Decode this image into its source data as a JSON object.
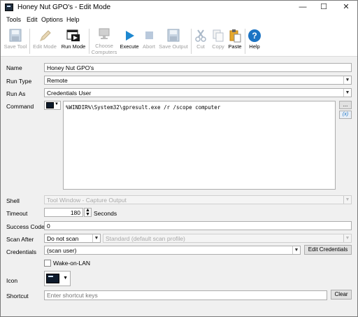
{
  "window": {
    "title": "Honey Nut GPO's - Edit Mode",
    "minimize_glyph": "—",
    "maximize_glyph": "☐",
    "close_glyph": "✕"
  },
  "menu": [
    "Tools",
    "Edit",
    "Options",
    "Help"
  ],
  "toolbar": {
    "save_tool": "Save Tool",
    "edit_mode": "Edit Mode",
    "run_mode": "Run Mode",
    "choose_computers_line1": "Choose",
    "choose_computers_line2": "Computers",
    "execute": "Execute",
    "abort": "Abort",
    "save_output": "Save Output",
    "cut": "Cut",
    "copy": "Copy",
    "paste": "Paste",
    "help": "Help"
  },
  "form": {
    "name_label": "Name",
    "name_value": "Honey Nut GPO's",
    "run_type_label": "Run Type",
    "run_type_value": "Remote",
    "run_as_label": "Run As",
    "run_as_value": "Credentials User",
    "command_label": "Command",
    "command_value": "%WINDIR%\\System32\\gpresult.exe /r /scope computer",
    "ellipsis": "...",
    "variables_label": "(x)",
    "shell_label": "Shell",
    "shell_value": "Tool Window - Capture Output",
    "timeout_label": "Timeout",
    "timeout_value": "180",
    "timeout_unit": "Seconds",
    "success_codes_label": "Success Codes",
    "success_codes_value": "0",
    "scan_after_label": "Scan After",
    "scan_after_value": "Do not scan",
    "scan_profile_value": "Standard (default scan profile)",
    "credentials_label": "Credentials",
    "credentials_value": "(scan user)",
    "edit_credentials": "Edit Credentials",
    "wake_on_lan": "Wake-on-LAN",
    "icon_label": "Icon",
    "shortcut_label": "Shortcut",
    "shortcut_placeholder": "Enter shortcut keys",
    "clear": "Clear"
  },
  "colors": {
    "accent_blue": "#1e88d0",
    "help_blue": "#1c74c4",
    "disabled_text": "#a0a0a0"
  }
}
